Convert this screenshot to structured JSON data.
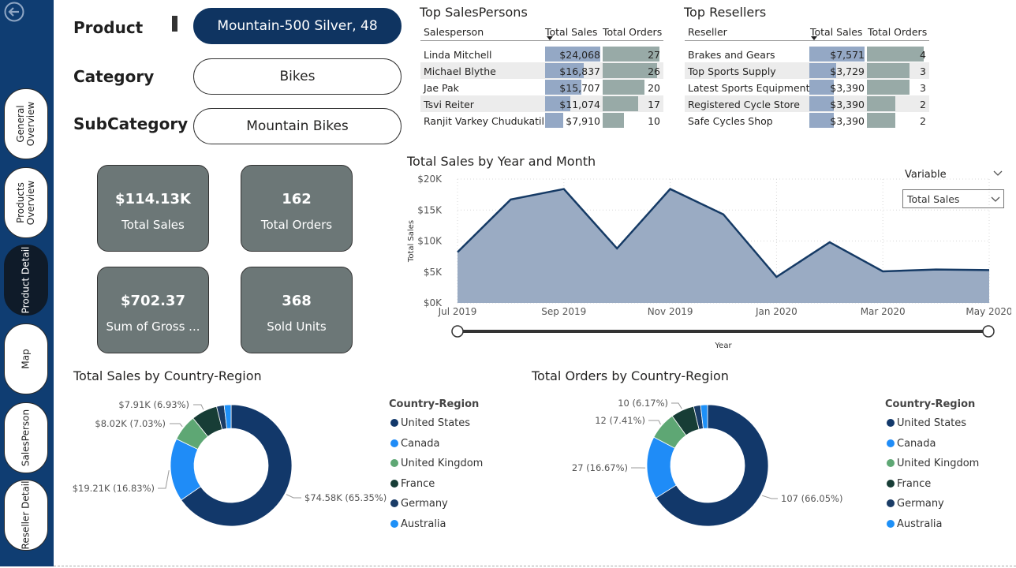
{
  "nav": {
    "items": [
      {
        "label": "General\nOverview",
        "active": false
      },
      {
        "label": "Products\nOverview",
        "active": false
      },
      {
        "label": "Product Detail",
        "active": true
      },
      {
        "label": "Map",
        "active": false
      },
      {
        "label": "SalesPerson",
        "active": false
      },
      {
        "label": "Reseller Detail",
        "active": false
      }
    ],
    "back_icon": "back-arrow-icon"
  },
  "slicers": {
    "product": {
      "label": "Product",
      "value": "Mountain-500 Silver, 48"
    },
    "category": {
      "label": "Category",
      "value": "Bikes"
    },
    "subcategory": {
      "label": "SubCategory",
      "value": "Mountain Bikes"
    }
  },
  "cards": [
    {
      "value": "$114.13K",
      "label": "Total Sales"
    },
    {
      "value": "162",
      "label": "Total Orders"
    },
    {
      "value": "$702.37",
      "label": "Sum of Gross ..."
    },
    {
      "value": "368",
      "label": "Sold Units"
    }
  ],
  "colors": {
    "navy": "#0f3d72",
    "bar": "#94a8c5",
    "orders_bar": "#98aaa7",
    "area": "#9aabc3",
    "line": "#153a65"
  },
  "top_salespersons": {
    "title": "Top SalesPersons",
    "columns": [
      "Salesperson",
      "Total Sales",
      "Total Orders"
    ],
    "rows": [
      {
        "name": "Linda Mitchell",
        "sales": "$24,068",
        "sales_value": 24068,
        "orders": 27
      },
      {
        "name": "Michael Blythe",
        "sales": "$16,837",
        "sales_value": 16837,
        "orders": 26
      },
      {
        "name": "Jae Pak",
        "sales": "$15,707",
        "sales_value": 15707,
        "orders": 20
      },
      {
        "name": "Tsvi Reiter",
        "sales": "$11,074",
        "sales_value": 11074,
        "orders": 17
      },
      {
        "name": "Ranjit Varkey Chudukatil",
        "sales": "$7,910",
        "sales_value": 7910,
        "orders": 10
      }
    ]
  },
  "top_resellers": {
    "title": "Top Resellers",
    "columns": [
      "Reseller",
      "Total Sales",
      "Total Orders"
    ],
    "rows": [
      {
        "name": "Brakes and Gears",
        "sales": "$7,571",
        "sales_value": 7571,
        "orders": 4
      },
      {
        "name": "Top Sports Supply",
        "sales": "$3,729",
        "sales_value": 3729,
        "orders": 3
      },
      {
        "name": "Latest Sports Equipment",
        "sales": "$3,390",
        "sales_value": 3390,
        "orders": 3
      },
      {
        "name": "Registered Cycle Store",
        "sales": "$3,390",
        "sales_value": 3390,
        "orders": 2
      },
      {
        "name": "Safe Cycles Shop",
        "sales": "$3,390",
        "sales_value": 3390,
        "orders": 2
      }
    ]
  },
  "variable_slicer": {
    "label": "Variable",
    "value": "Total Sales"
  },
  "chart_data": [
    {
      "type": "area",
      "title": "Total Sales by Year and Month",
      "xlabel": "Year",
      "ylabel": "Total Sales",
      "x": [
        "2019-07",
        "2019-08",
        "2019-09",
        "2019-10",
        "2019-11",
        "2019-12",
        "2020-01",
        "2020-02",
        "2020-03",
        "2020-04",
        "2020-05"
      ],
      "x_ticks": [
        "Jul 2019",
        "Sep 2019",
        "Nov 2019",
        "Jan 2020",
        "Mar 2020",
        "May 2020"
      ],
      "values": [
        8200,
        16700,
        18400,
        8800,
        18400,
        14300,
        4200,
        9800,
        5100,
        5400,
        5300
      ],
      "y_ticks": [
        "$0K",
        "$5K",
        "$10K",
        "$15K",
        "$20K"
      ],
      "ylim": [
        0,
        20000
      ],
      "grid": true
    },
    {
      "type": "pie",
      "title": "Total Sales by Country-Region",
      "legend_title": "Country-Region",
      "legend_position": "right",
      "categories": [
        "United States",
        "Canada",
        "United Kingdom",
        "France",
        "Germany",
        "Australia"
      ],
      "values": [
        74.58,
        19.21,
        8.02,
        7.91,
        2.3,
        2.1
      ],
      "colors": [
        "#12386a",
        "#1f8cf7",
        "#5ea774",
        "#173d36",
        "#1a3c66",
        "#1e90f7"
      ],
      "labels": [
        {
          "text": "$74.58K (65.35%)",
          "slice": 0
        },
        {
          "text": "$19.21K (16.83%)",
          "slice": 1
        },
        {
          "text": "$8.02K (7.03%)",
          "slice": 2
        },
        {
          "text": "$7.91K (6.93%)",
          "slice": 3
        }
      ]
    },
    {
      "type": "pie",
      "title": "Total Orders by Country-Region",
      "legend_title": "Country-Region",
      "legend_position": "right",
      "categories": [
        "United States",
        "Canada",
        "United Kingdom",
        "France",
        "Germany",
        "Australia"
      ],
      "values": [
        107,
        27,
        12,
        10,
        3,
        3
      ],
      "colors": [
        "#12386a",
        "#1f8cf7",
        "#5ea774",
        "#173d36",
        "#1a3c66",
        "#1e90f7"
      ],
      "labels": [
        {
          "text": "107 (66.05%)",
          "slice": 0
        },
        {
          "text": "27 (16.67%)",
          "slice": 1
        },
        {
          "text": "12 (7.41%)",
          "slice": 2
        },
        {
          "text": "10 (6.17%)",
          "slice": 3
        }
      ]
    }
  ]
}
